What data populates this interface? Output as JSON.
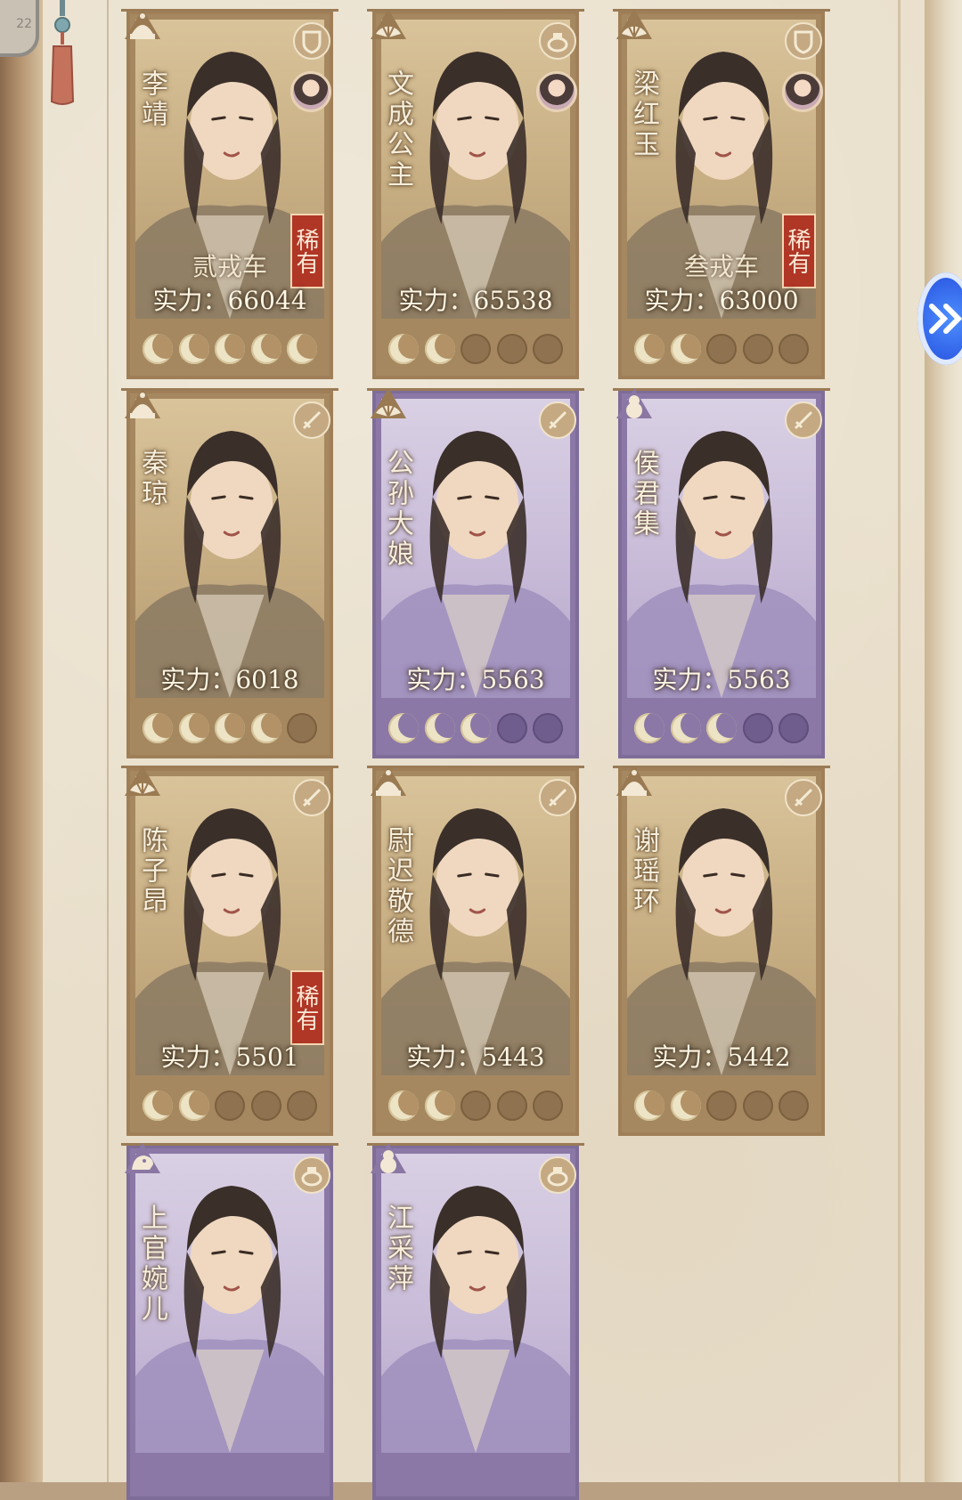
{
  "overlay_badge": "22",
  "heroes": [
    {
      "name": "李靖",
      "frame": "gold",
      "class_icon": "helmet-icon",
      "type_icon": "shield-icon",
      "avatar": true,
      "rarity": "稀有",
      "chariot": "贰戎车",
      "power": "实力：66044",
      "stars_filled": 5,
      "stars_total": 5
    },
    {
      "name": "文成公主",
      "frame": "gold",
      "class_icon": "fan-icon",
      "type_icon": "pot-icon",
      "avatar": true,
      "rarity": "",
      "chariot": "",
      "power": "实力：65538",
      "stars_filled": 2,
      "stars_total": 5
    },
    {
      "name": "梁红玉",
      "frame": "gold",
      "class_icon": "fan-icon",
      "type_icon": "shield-icon",
      "avatar": true,
      "rarity": "稀有",
      "chariot": "叁戎车",
      "power": "实力：63000",
      "stars_filled": 2,
      "stars_total": 5
    },
    {
      "name": "秦琼",
      "frame": "gold",
      "class_icon": "helmet-icon",
      "type_icon": "sword-icon",
      "avatar": false,
      "rarity": "",
      "chariot": "",
      "power": "实力：6018",
      "stars_filled": 4,
      "stars_total": 5
    },
    {
      "name": "公孙大娘",
      "frame": "purple",
      "class_icon": "fan-icon",
      "type_icon": "sword-icon",
      "avatar": false,
      "rarity": "",
      "chariot": "",
      "power": "实力：5563",
      "stars_filled": 3,
      "stars_total": 5
    },
    {
      "name": "侯君集",
      "frame": "purple",
      "class_icon": "gourd-icon",
      "type_icon": "sword-icon",
      "avatar": false,
      "rarity": "",
      "chariot": "",
      "power": "实力：5563",
      "stars_filled": 3,
      "stars_total": 5
    },
    {
      "name": "陈子昂",
      "frame": "gold",
      "class_icon": "fan-icon",
      "type_icon": "sword-icon",
      "avatar": false,
      "rarity": "稀有",
      "chariot": "",
      "power": "实力：5501",
      "stars_filled": 2,
      "stars_total": 5
    },
    {
      "name": "尉迟敬德",
      "frame": "gold",
      "class_icon": "helmet-icon",
      "type_icon": "sword-icon",
      "avatar": false,
      "rarity": "",
      "chariot": "",
      "power": "实力：5443",
      "stars_filled": 2,
      "stars_total": 5
    },
    {
      "name": "谢瑶环",
      "frame": "gold",
      "class_icon": "helmet-icon",
      "type_icon": "sword-icon",
      "avatar": false,
      "rarity": "",
      "chariot": "",
      "power": "实力：5442",
      "stars_filled": 2,
      "stars_total": 5
    },
    {
      "name": "上官婉儿",
      "frame": "purple",
      "class_icon": "lion-icon",
      "type_icon": "pot-icon",
      "avatar": false,
      "rarity": "",
      "chariot": "",
      "power": "",
      "stars_filled": 0,
      "stars_total": 0
    },
    {
      "name": "江采萍",
      "frame": "purple",
      "class_icon": "gourd-icon",
      "type_icon": "pot-icon",
      "avatar": false,
      "rarity": "",
      "chariot": "",
      "power": "",
      "stars_filled": 0,
      "stars_total": 0
    }
  ]
}
